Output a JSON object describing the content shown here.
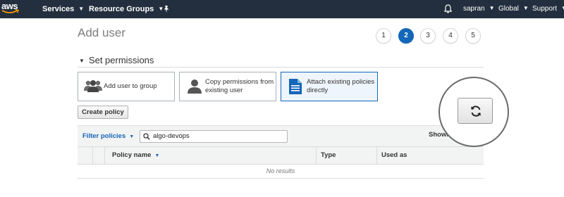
{
  "navbar": {
    "logo_text": "aws",
    "services": "Services",
    "resource_groups": "Resource Groups",
    "caret": "⌄",
    "pin_icon": "pin-icon",
    "bell_icon": "bell-icon",
    "user": "sapran",
    "region": "Global",
    "support": "Support",
    "colors": {
      "bg": "#232f3e",
      "logo_smile": "#ff9900"
    }
  },
  "page": {
    "title": "Add user",
    "steps": [
      "1",
      "2",
      "3",
      "4",
      "5"
    ],
    "active_step": "2",
    "section_title": "Set permissions",
    "options": [
      {
        "label": "Add user to group",
        "icon": "group-icon",
        "selected": false
      },
      {
        "label": "Copy permissions from\nexisting user",
        "icon": "user-icon",
        "selected": false
      },
      {
        "label": "Attach existing policies\ndirectly",
        "icon": "document-icon",
        "selected": true
      }
    ],
    "create_policy": "Create policy",
    "filter_label": "Filter policies",
    "search_value": "algo-devops",
    "showing": "Showi",
    "columns": [
      "Policy name",
      "Type",
      "Used as"
    ],
    "no_results": "No results",
    "refresh_icon": "refresh-icon",
    "accent_color": "#1466b8"
  }
}
